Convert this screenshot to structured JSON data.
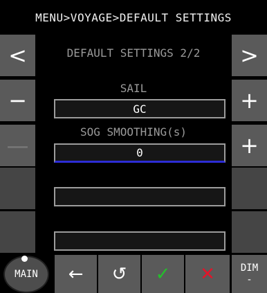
{
  "header": {
    "title": "MENU>VOYAGE>DEFAULT SETTINGS"
  },
  "nav": {
    "prev_glyph": "<",
    "next_glyph": ">",
    "page_label": "DEFAULT SETTINGS 2/2"
  },
  "settings": [
    {
      "label": "SAIL",
      "value": "GC",
      "decrement": "−",
      "increment": "+"
    },
    {
      "label": "SOG SMOOTHING(s)",
      "value": "0",
      "decrement": "—",
      "increment": "+"
    }
  ],
  "empty_fields": [
    "",
    ""
  ],
  "bottom_bar": {
    "main_label": "MAIN",
    "back_glyph": "←",
    "reset_glyph": "↺",
    "confirm_glyph": "✓",
    "cancel_glyph": "✕",
    "dim_label": "DIM",
    "dim_value": "-"
  },
  "colors": {
    "confirm": "#22c12a",
    "cancel": "#e0162b",
    "active_underline": "#2d2dd6",
    "button_gray": "#5a5a5a"
  }
}
